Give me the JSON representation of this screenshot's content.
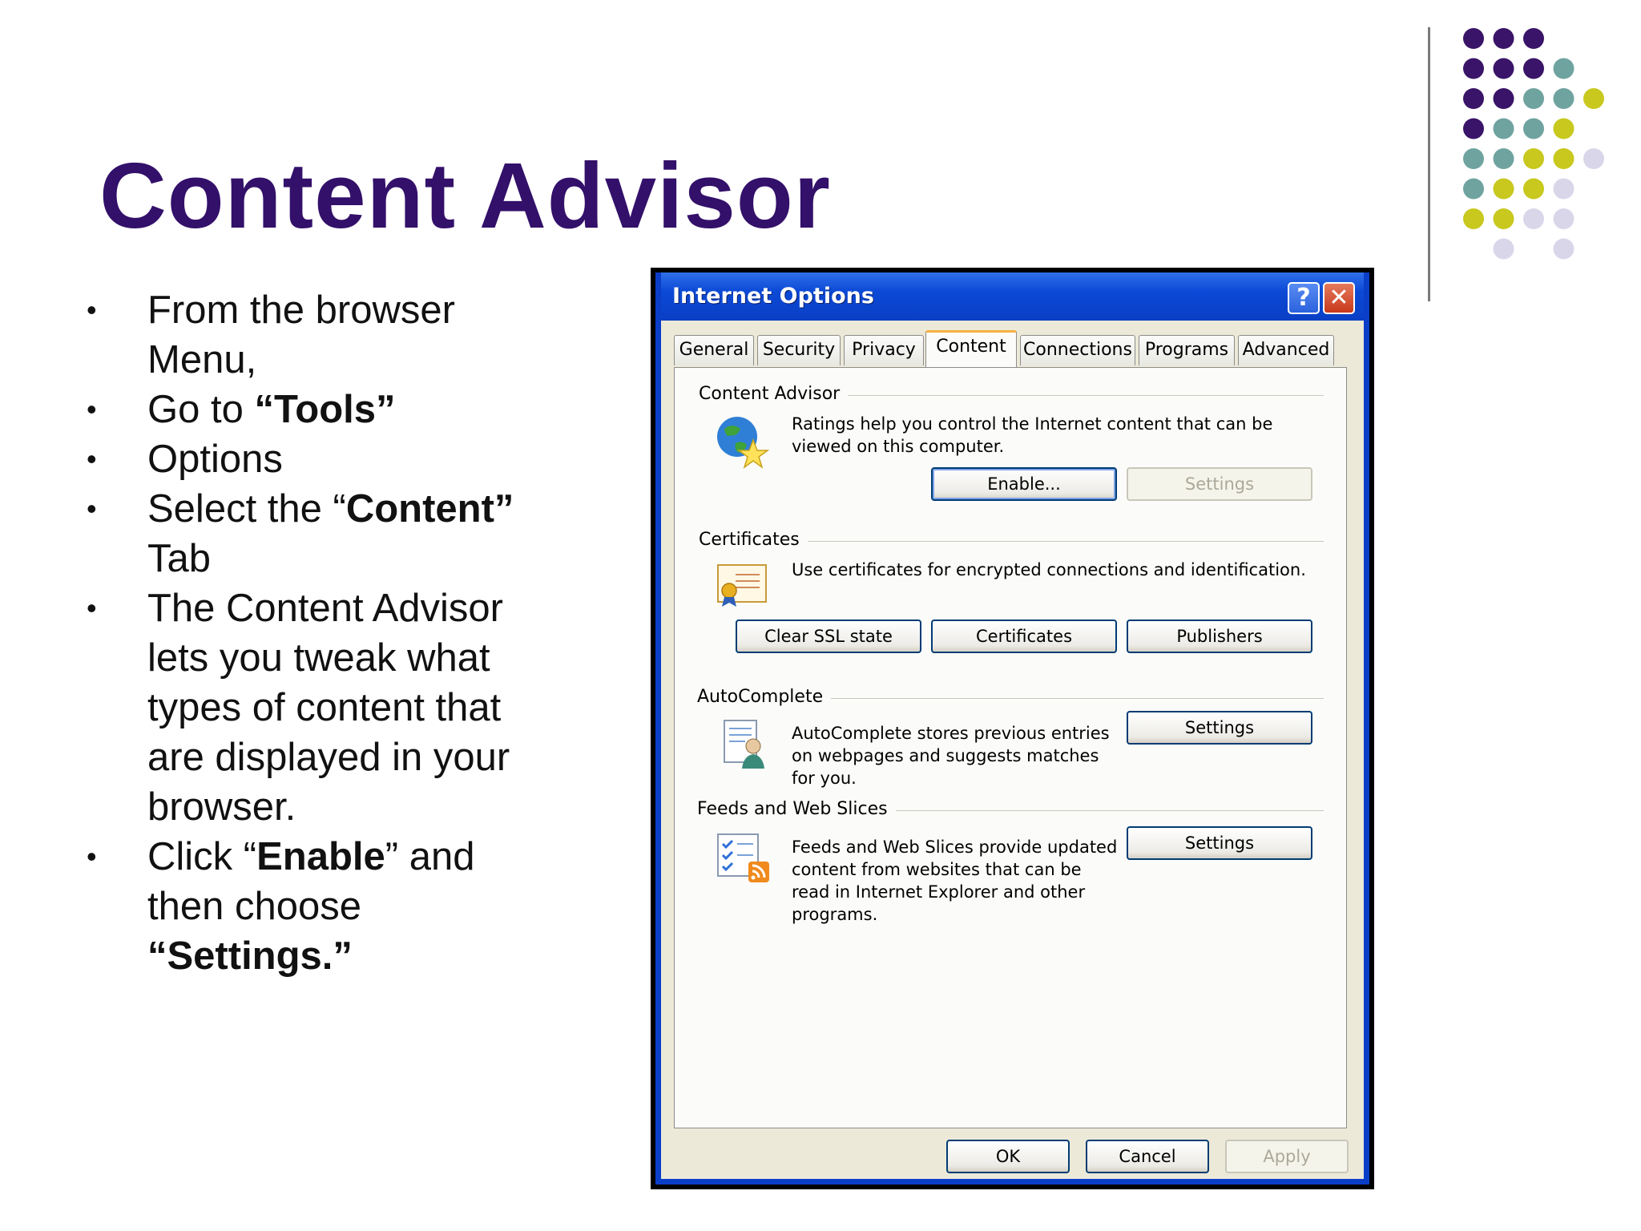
{
  "slide": {
    "title": "Content Advisor",
    "bullets": {
      "b1_line1": "From the browser",
      "b1_line2": "Menu,",
      "b2_pre": "Go to ",
      "b2_bold": "“Tools”",
      "b3": "Options",
      "b4_pre": "Select the “",
      "b4_bold": "Content”",
      "b4_line2": "Tab",
      "b5_line1": "The Content Advisor",
      "b5_line2": "lets you tweak what",
      "b5_line3": "types of content that",
      "b5_line4": "are displayed in your",
      "b5_line5": "browser.",
      "b6_pre": "Click “",
      "b6_bold": "Enable",
      "b6_post": "” and",
      "b6_line2": "then choose",
      "b6_line3": "“Settings.”",
      "marker": "•"
    },
    "colors": {
      "title": "#33106a",
      "dot_purple": "#3a1468",
      "dot_teal": "#6fa3a0",
      "dot_yellow": "#c8c81e",
      "dot_lavender": "#d9d6ea"
    }
  },
  "window": {
    "title": "Internet Options",
    "help_label": "?",
    "close_label": "✕",
    "tabs": [
      "General",
      "Security",
      "Privacy",
      "Content",
      "Connections",
      "Programs",
      "Advanced"
    ],
    "active_tab": "Content",
    "content_advisor": {
      "label": "Content Advisor",
      "description_line1": "Ratings help you control the Internet content that can be",
      "description_line2": "viewed on this computer.",
      "enable_button": "Enable...",
      "settings_button": "Settings",
      "icon": "globe-star-icon"
    },
    "certificates": {
      "label": "Certificates",
      "description": "Use certificates for encrypted connections and identification.",
      "clear_ssl_button": "Clear SSL state",
      "certificates_button": "Certificates",
      "publishers_button": "Publishers",
      "icon": "certificate-icon"
    },
    "autocomplete": {
      "label": "AutoComplete",
      "description_line1": "AutoComplete stores previous entries",
      "description_line2": "on webpages and suggests matches",
      "description_line3": "for you.",
      "settings_button": "Settings",
      "icon": "autocomplete-user-icon"
    },
    "feeds": {
      "label": "Feeds and Web Slices",
      "description_line1": "Feeds and Web Slices provide updated",
      "description_line2": "content from websites that can be",
      "description_line3": "read in Internet Explorer and other",
      "description_line4": "programs.",
      "settings_button": "Settings",
      "icon": "feeds-checklist-icon"
    },
    "footer": {
      "ok": "OK",
      "cancel": "Cancel",
      "apply": "Apply"
    }
  }
}
